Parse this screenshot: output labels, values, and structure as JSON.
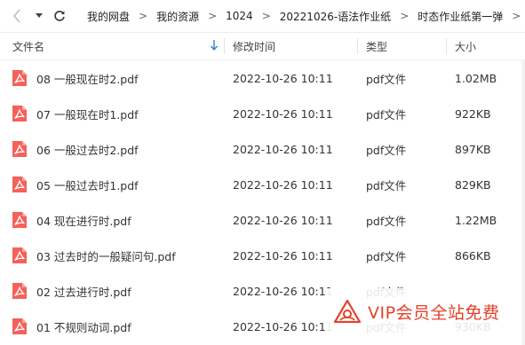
{
  "breadcrumb": [
    "我的网盘",
    "我的资源",
    "1024",
    "20221026-语法作业纸",
    "时态作业纸第一弹"
  ],
  "columns": {
    "name": "文件名",
    "modified": "修改时间",
    "type": "类型",
    "size": "大小"
  },
  "files": [
    {
      "name": "08 一般现在时2.pdf",
      "modified": "2022-10-26 10:11",
      "type": "pdf文件",
      "size": "1.02MB"
    },
    {
      "name": "07 一般现在时1.pdf",
      "modified": "2022-10-26 10:11",
      "type": "pdf文件",
      "size": "922KB"
    },
    {
      "name": "06 一般过去时2.pdf",
      "modified": "2022-10-26 10:11",
      "type": "pdf文件",
      "size": "897KB"
    },
    {
      "name": "05 一般过去时1.pdf",
      "modified": "2022-10-26 10:11",
      "type": "pdf文件",
      "size": "829KB"
    },
    {
      "name": "04 现在进行时.pdf",
      "modified": "2022-10-26 10:11",
      "type": "pdf文件",
      "size": "1.22MB"
    },
    {
      "name": "03 过去时的一般疑问句.pdf",
      "modified": "2022-10-26 10:11",
      "type": "pdf文件",
      "size": "866KB"
    },
    {
      "name": "02 过去进行时.pdf",
      "modified": "2022-10-26 10:11",
      "type": "pdf文件",
      "size": ""
    },
    {
      "name": "01 不规则动词.pdf",
      "modified": "2022-10-26 10:11",
      "type": "pdf文件",
      "size": "930KB"
    }
  ],
  "watermark": "VIP会员全站免费",
  "colors": {
    "pdf_icon": "#f4615c",
    "watermark": "#e5402a",
    "sort_arrow": "#3a7bd5"
  }
}
